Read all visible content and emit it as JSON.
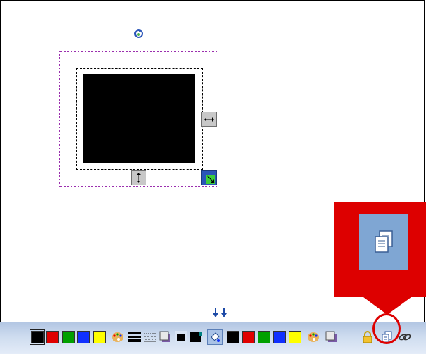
{
  "canvas": {
    "object": "black rectangle",
    "handles": [
      "rotate",
      "resize-horizontal",
      "resize-vertical",
      "resize-corner"
    ]
  },
  "callout": {
    "icon": "copy-page-icon",
    "arrow": "down-arrow-icon"
  },
  "collapse_control": {
    "icon": "double-down-arrow-icon"
  },
  "toolbar": {
    "line_colors": [
      "#000000",
      "#e00000",
      "#00a000",
      "#1030ff",
      "#ffff00"
    ],
    "fill_colors": [
      "#000000",
      "#e00000",
      "#00a000",
      "#1030ff",
      "#ffff00"
    ],
    "tools": [
      "palette-icon",
      "line-thickness-icon",
      "line-style-icon",
      "shadow-icon",
      "fill-type-icon",
      "paint-bucket-icon",
      "palette-icon",
      "shadow-icon",
      "lock-icon",
      "copy-page-icon",
      "link-icon"
    ]
  }
}
